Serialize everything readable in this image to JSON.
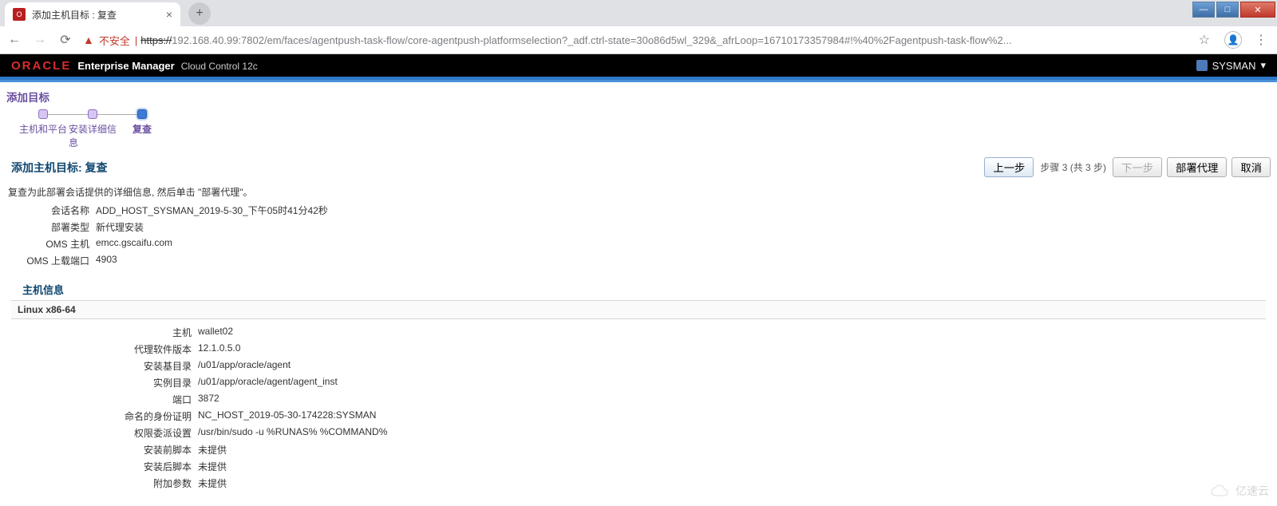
{
  "browser": {
    "tab_title": "添加主机目标 : 复查",
    "insecure_label": "不安全",
    "url_scheme": "https://",
    "url_host": "192.168.40.99",
    "url_port_path": ":7802/em/faces/agentpush-task-flow/core-agentpush-platformselection?_adf.ctrl-state=30o86d5wl_329&_afrLoop=16710173357984#!%40%2Fagentpush-task-flow%2..."
  },
  "header": {
    "logo": "ORACLE",
    "product": "Enterprise Manager",
    "edition": "Cloud Control 12c",
    "user": "SYSMAN"
  },
  "page": {
    "breadcrumb": "添加目标",
    "train": {
      "step1": "主机和平台",
      "step2": "安装详细信息",
      "step3": "复查"
    },
    "title": "添加主机目标: 复查",
    "buttons": {
      "back": "上一步",
      "step_info": "步骤 3 (共 3 步)",
      "next": "下一步",
      "deploy": "部署代理",
      "cancel": "取消"
    },
    "desc": "复查为此部署会话提供的详细信息, 然后单击 \"部署代理\"。",
    "summary": {
      "session_name_label": "会话名称",
      "session_name": "ADD_HOST_SYSMAN_2019-5-30_下午05时41分42秒",
      "deploy_type_label": "部署类型",
      "deploy_type": "新代理安装",
      "oms_host_label": "OMS 主机",
      "oms_host": "emcc.gscaifu.com",
      "oms_port_label": "OMS 上载端口",
      "oms_port": "4903"
    },
    "host_section_label": "主机信息",
    "platform_label": "Linux x86-64",
    "host": {
      "host_label": "主机",
      "host": "wallet02",
      "agent_ver_label": "代理软件版本",
      "agent_ver": "12.1.0.5.0",
      "base_dir_label": "安装基目录",
      "base_dir": "/u01/app/oracle/agent",
      "inst_dir_label": "实例目录",
      "inst_dir": "/u01/app/oracle/agent/agent_inst",
      "port_label": "端口",
      "port": "3872",
      "named_cred_label": "命名的身份证明",
      "named_cred": "NC_HOST_2019-05-30-174228:SYSMAN",
      "priv_label": "权限委派设置",
      "priv": "/usr/bin/sudo -u %RUNAS% %COMMAND%",
      "pre_label": "安装前脚本",
      "pre": "未提供",
      "post_label": "安装后脚本",
      "post": "未提供",
      "extra_label": "附加参数",
      "extra": "未提供"
    }
  },
  "watermark": "亿速云"
}
